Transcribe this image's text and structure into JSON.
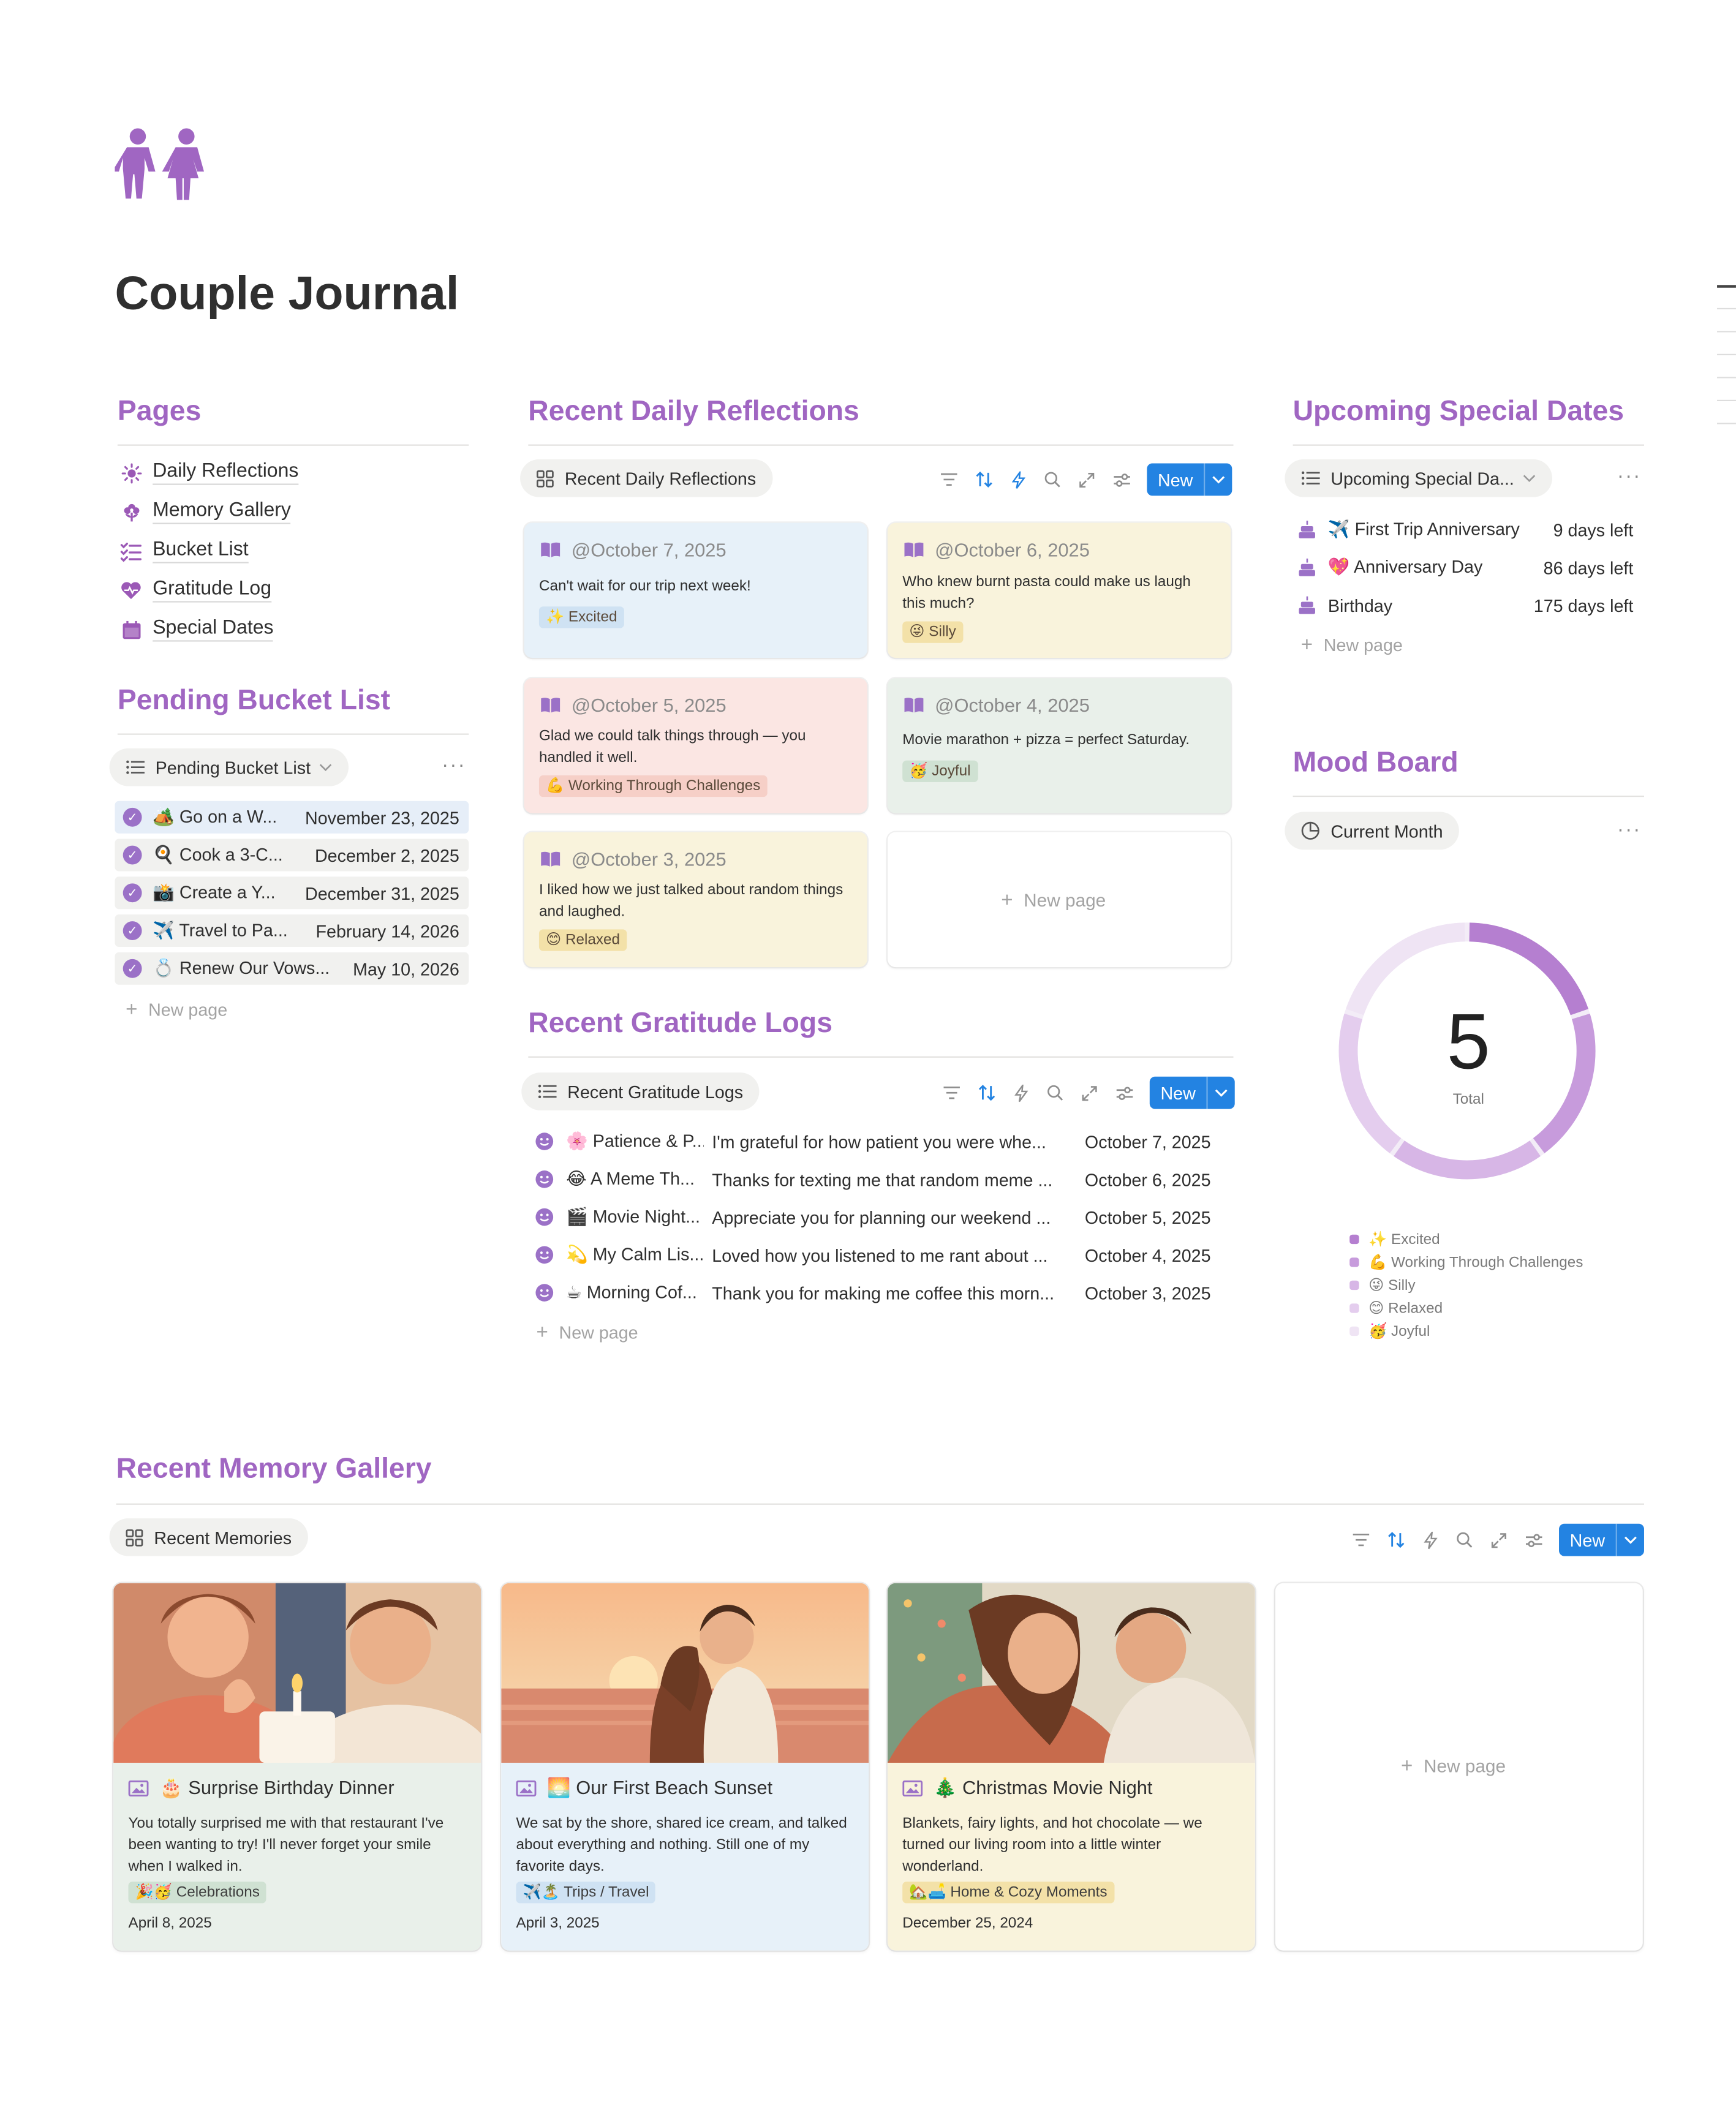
{
  "page": {
    "title": "Couple Journal",
    "icon": "couple-icon"
  },
  "pages": {
    "title": "Pages",
    "items": [
      {
        "label": "Daily Reflections",
        "icon": "sun-icon"
      },
      {
        "label": "Memory Gallery",
        "icon": "flower-icon"
      },
      {
        "label": "Bucket List",
        "icon": "checklist-icon"
      },
      {
        "label": "Gratitude Log",
        "icon": "heart-icon"
      },
      {
        "label": "Special Dates",
        "icon": "calendar-icon"
      }
    ]
  },
  "pending_bucket": {
    "title": "Pending Bucket List",
    "view": "Pending Bucket List",
    "dots": "···",
    "rows": [
      {
        "name": "🏕️ Go on a W...",
        "date": "November 23, 2025"
      },
      {
        "name": "🍳 Cook a 3-C...",
        "date": "December 2, 2025"
      },
      {
        "name": "📸 Create a Y...",
        "date": "December 31, 2025"
      },
      {
        "name": "✈️ Travel to Pa...",
        "date": "February 14, 2026"
      },
      {
        "name": "💍 Renew Our Vows...",
        "date": "May 10, 2026"
      }
    ],
    "new_page": "New page"
  },
  "reflections": {
    "title": "Recent Daily Reflections",
    "view": "Recent Daily Reflections",
    "new_label": "New",
    "cards": [
      {
        "date": "@October 7, 2025",
        "text": "Can't wait for our trip next week!",
        "tag": "✨ Excited",
        "bg": "#e7f1f9",
        "tagbg": "#cfe2f3"
      },
      {
        "date": "@October 6, 2025",
        "text": "Who knew burnt pasta could make us laugh this much?",
        "tag": "😜 Silly",
        "bg": "#f9f3dc",
        "tagbg": "#f3e1a8"
      },
      {
        "date": "@October 5, 2025",
        "text": "Glad we could talk things through — you handled it well.",
        "tag": "💪 Working Through Challenges",
        "bg": "#fbe6e3",
        "tagbg": "#f6cfc7"
      },
      {
        "date": "@October 4, 2025",
        "text": "Movie marathon + pizza = perfect Saturday.",
        "tag": "🥳 Joyful",
        "bg": "#e9f0ea",
        "tagbg": "#cfe1d2"
      },
      {
        "date": "@October 3, 2025",
        "text": "I liked how we just talked about random things and laughed.",
        "tag": "😊 Relaxed",
        "bg": "#f9f3dc",
        "tagbg": "#f3e1a8"
      }
    ],
    "new_page": "New page"
  },
  "gratitude": {
    "title": "Recent Gratitude Logs",
    "view": "Recent Gratitude Logs",
    "new_label": "New",
    "rows": [
      {
        "name": "🌸 Patience & P...",
        "desc": "I'm grateful for how patient you were whe...",
        "date": "October 7, 2025"
      },
      {
        "name": "😂 A Meme Th...",
        "desc": "Thanks for texting me that random meme ...",
        "date": "October 6, 2025"
      },
      {
        "name": "🎬 Movie Night...",
        "desc": "Appreciate you for planning our weekend ...",
        "date": "October 5, 2025"
      },
      {
        "name": "💫 My Calm Lis...",
        "desc": "Loved how you listened to me rant about ...",
        "date": "October 4, 2025"
      },
      {
        "name": "☕ Morning Cof...",
        "desc": "Thank you for making me coffee this morn...",
        "date": "October 3, 2025"
      }
    ],
    "new_page": "New page"
  },
  "special_dates": {
    "title": "Upcoming Special Dates",
    "view": "Upcoming Special Da...",
    "dots": "···",
    "rows": [
      {
        "name": "✈️ First Trip Anniversary",
        "left": "9 days left"
      },
      {
        "name": "💖 Anniversary Day",
        "left": "86 days left"
      },
      {
        "name": "Birthday",
        "left": "175 days left"
      }
    ],
    "new_page": "New page"
  },
  "mood": {
    "title": "Mood Board",
    "view": "Current Month",
    "dots": "···",
    "total": "5",
    "total_label": "Total",
    "legend": [
      {
        "label": "✨ Excited",
        "color": "#b57fd0"
      },
      {
        "label": "💪 Working Through Challenges",
        "color": "#c79bdc"
      },
      {
        "label": "😜 Silly",
        "color": "#d7b6e6"
      },
      {
        "label": "😊 Relaxed",
        "color": "#e4cdee"
      },
      {
        "label": "🥳 Joyful",
        "color": "#efe4f4"
      }
    ]
  },
  "memory": {
    "title": "Recent Memory Gallery",
    "view": "Recent Memories",
    "new_label": "New",
    "cards": [
      {
        "title": "🎂 Surprise Birthday Dinner",
        "desc": "You totally surprised me with that restaurant I've been wanting to try! I'll never forget your smile when I walked in.",
        "tag": "🎉🥳 Celebrations",
        "date": "April 8, 2025",
        "bg": "#e9f0ea",
        "tagbg": "#cfe1d2"
      },
      {
        "title": "🌅 Our First Beach Sunset",
        "desc": "We sat by the shore, shared ice cream, and talked about everything and nothing. Still one of my favorite days.",
        "tag": "✈️🏝️ Trips / Travel",
        "date": "April 3, 2025",
        "bg": "#e7f1f9",
        "tagbg": "#cfe2f3"
      },
      {
        "title": "🎄 Christmas Movie Night",
        "desc": "Blankets, fairy lights, and hot chocolate — we turned our living room into a little winter wonderland.",
        "tag": "🏡🛋️ Home & Cozy Moments",
        "date": "December 25, 2024",
        "bg": "#f9f3dc",
        "tagbg": "#f3e1a8"
      }
    ],
    "new_page": "New page"
  }
}
